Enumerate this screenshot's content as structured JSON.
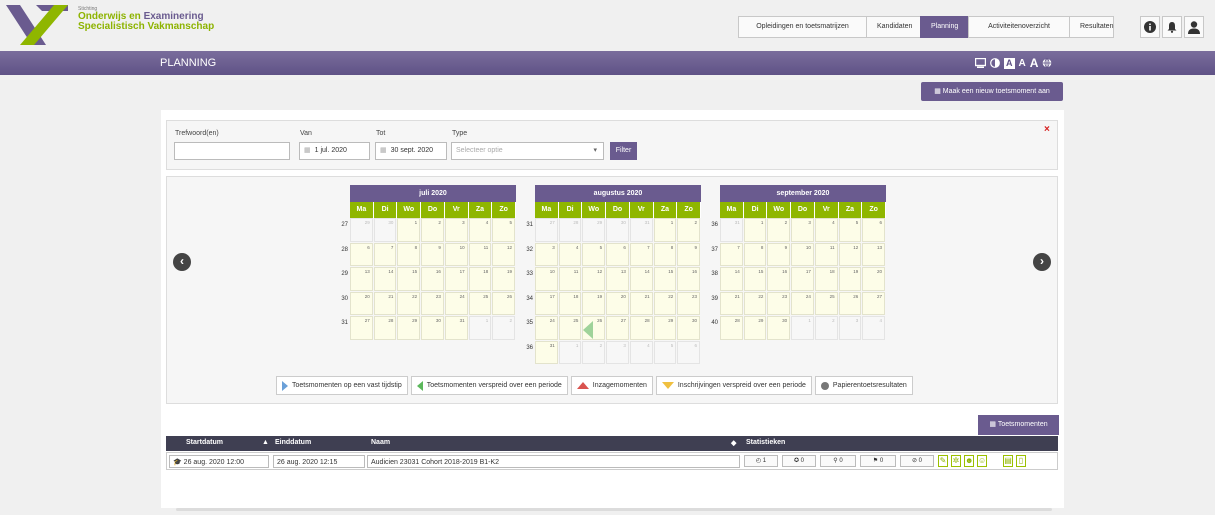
{
  "header": {
    "logo_small": "Stichting",
    "logo_line1_a": "Onderwijs en ",
    "logo_line1_b": "Examinering",
    "logo_line2": "Specialistisch Vakmanschap",
    "nav": [
      {
        "label": "Opleidingen en toetsmatrijzen",
        "active": false
      },
      {
        "label": "Kandidaten",
        "active": false
      },
      {
        "label": "Planning",
        "active": true
      },
      {
        "label": "Activiteitenoverzicht",
        "active": false
      },
      {
        "label": "Resultaten",
        "active": false
      }
    ],
    "icons": [
      "info-icon",
      "bell-icon",
      "user-icon"
    ]
  },
  "page": {
    "title": "PLANNING",
    "a11y": {
      "a1": "A",
      "a2": "A",
      "a3": "A"
    },
    "new_button": "Maak een nieuw toetsmoment aan"
  },
  "filter": {
    "keyword_label": "Trefwoord(en)",
    "keyword_value": "",
    "from_label": "Van",
    "from_value": "1 jul. 2020",
    "to_label": "Tot",
    "to_value": "30 sept. 2020",
    "type_label": "Type",
    "type_placeholder": "Selecteer optie",
    "filter_button": "Filter",
    "close": "×"
  },
  "calendar": {
    "day_headers": [
      "Ma",
      "Di",
      "Wo",
      "Do",
      "Vr",
      "Za",
      "Zo"
    ],
    "months": [
      {
        "title": "juli 2020",
        "weeks": [
          {
            "nr": "27",
            "days": [
              [
                "29",
                1
              ],
              [
                "30",
                1
              ],
              [
                "1",
                0
              ],
              [
                "2",
                0
              ],
              [
                "3",
                0
              ],
              [
                "4",
                0
              ],
              [
                "5",
                0
              ]
            ]
          },
          {
            "nr": "28",
            "days": [
              [
                "6",
                0
              ],
              [
                "7",
                0
              ],
              [
                "8",
                0
              ],
              [
                "9",
                0
              ],
              [
                "10",
                0
              ],
              [
                "11",
                0
              ],
              [
                "12",
                0
              ]
            ]
          },
          {
            "nr": "29",
            "days": [
              [
                "13",
                0
              ],
              [
                "14",
                0
              ],
              [
                "15",
                0
              ],
              [
                "16",
                0
              ],
              [
                "17",
                0
              ],
              [
                "18",
                0
              ],
              [
                "19",
                0
              ]
            ]
          },
          {
            "nr": "30",
            "days": [
              [
                "20",
                0
              ],
              [
                "21",
                0
              ],
              [
                "22",
                0
              ],
              [
                "23",
                0
              ],
              [
                "24",
                0
              ],
              [
                "25",
                0
              ],
              [
                "26",
                0
              ]
            ]
          },
          {
            "nr": "31",
            "days": [
              [
                "27",
                0
              ],
              [
                "28",
                0
              ],
              [
                "29",
                0
              ],
              [
                "30",
                0
              ],
              [
                "31",
                0
              ],
              [
                "1",
                1
              ],
              [
                "2",
                1
              ]
            ]
          }
        ]
      },
      {
        "title": "augustus 2020",
        "weeks": [
          {
            "nr": "31",
            "days": [
              [
                "27",
                1
              ],
              [
                "28",
                1
              ],
              [
                "29",
                1
              ],
              [
                "30",
                1
              ],
              [
                "31",
                1
              ],
              [
                "1",
                0
              ],
              [
                "2",
                0
              ]
            ]
          },
          {
            "nr": "32",
            "days": [
              [
                "3",
                0
              ],
              [
                "4",
                0
              ],
              [
                "5",
                0
              ],
              [
                "6",
                0
              ],
              [
                "7",
                0
              ],
              [
                "8",
                0
              ],
              [
                "9",
                0
              ]
            ]
          },
          {
            "nr": "33",
            "days": [
              [
                "10",
                0
              ],
              [
                "11",
                0
              ],
              [
                "12",
                0
              ],
              [
                "13",
                0
              ],
              [
                "14",
                0
              ],
              [
                "15",
                0
              ],
              [
                "16",
                0
              ]
            ]
          },
          {
            "nr": "34",
            "days": [
              [
                "17",
                0
              ],
              [
                "18",
                0
              ],
              [
                "19",
                0
              ],
              [
                "20",
                0
              ],
              [
                "21",
                0
              ],
              [
                "22",
                0
              ],
              [
                "23",
                0
              ]
            ]
          },
          {
            "nr": "35",
            "days": [
              [
                "24",
                0
              ],
              [
                "25",
                0
              ],
              [
                "26",
                0
              ],
              [
                "27",
                0
              ],
              [
                "28",
                0
              ],
              [
                "29",
                0
              ],
              [
                "30",
                0
              ]
            ]
          },
          {
            "nr": "36",
            "days": [
              [
                "31",
                0
              ],
              [
                "1",
                1
              ],
              [
                "2",
                1
              ],
              [
                "3",
                1
              ],
              [
                "4",
                1
              ],
              [
                "5",
                1
              ],
              [
                "6",
                1
              ]
            ]
          }
        ]
      },
      {
        "title": "september 2020",
        "weeks": [
          {
            "nr": "36",
            "days": [
              [
                "31",
                1
              ],
              [
                "1",
                0
              ],
              [
                "2",
                0
              ],
              [
                "3",
                0
              ],
              [
                "4",
                0
              ],
              [
                "5",
                0
              ],
              [
                "6",
                0
              ]
            ]
          },
          {
            "nr": "37",
            "days": [
              [
                "7",
                0
              ],
              [
                "8",
                0
              ],
              [
                "9",
                0
              ],
              [
                "10",
                0
              ],
              [
                "11",
                0
              ],
              [
                "12",
                0
              ],
              [
                "13",
                0
              ]
            ]
          },
          {
            "nr": "38",
            "days": [
              [
                "14",
                0
              ],
              [
                "15",
                0
              ],
              [
                "16",
                0
              ],
              [
                "17",
                0
              ],
              [
                "18",
                0
              ],
              [
                "19",
                0
              ],
              [
                "20",
                0
              ]
            ]
          },
          {
            "nr": "39",
            "days": [
              [
                "21",
                0
              ],
              [
                "22",
                0
              ],
              [
                "23",
                0
              ],
              [
                "24",
                0
              ],
              [
                "25",
                0
              ],
              [
                "26",
                0
              ],
              [
                "27",
                0
              ]
            ]
          },
          {
            "nr": "40",
            "days": [
              [
                "28",
                0
              ],
              [
                "29",
                0
              ],
              [
                "30",
                0
              ],
              [
                "1",
                1
              ],
              [
                "2",
                1
              ],
              [
                "3",
                1
              ],
              [
                "4",
                1
              ]
            ]
          }
        ]
      }
    ],
    "event_marker_day": "26 augustus 2020"
  },
  "legend": [
    {
      "label": "Toetsmomenten op een vast tijdstip",
      "icon": "triangle-right-blue"
    },
    {
      "label": "Toetsmomenten verspreid over een periode",
      "icon": "triangle-left-green"
    },
    {
      "label": "Inzagemomenten",
      "icon": "triangle-up-red"
    },
    {
      "label": "Inschrijvingen verspreid over een periode",
      "icon": "triangle-down-yellow"
    },
    {
      "label": "Papierentoetsresultaten",
      "icon": "circle-grey"
    }
  ],
  "table": {
    "tab_label": "Toetsmomenten",
    "headers": {
      "start": "Startdatum",
      "end": "Einddatum",
      "name": "Naam",
      "stats": "Statistieken"
    },
    "rows": [
      {
        "start": "26 aug. 2020 12:00",
        "end": "26 aug. 2020 12:15",
        "name": "Audicien 23031 Cohort 2018-2019 B1-K2",
        "stats": [
          "1",
          "0",
          "0",
          "0",
          "0"
        ]
      }
    ]
  },
  "colors": {
    "purple": "#6a5b8f",
    "green": "#8fb600"
  }
}
